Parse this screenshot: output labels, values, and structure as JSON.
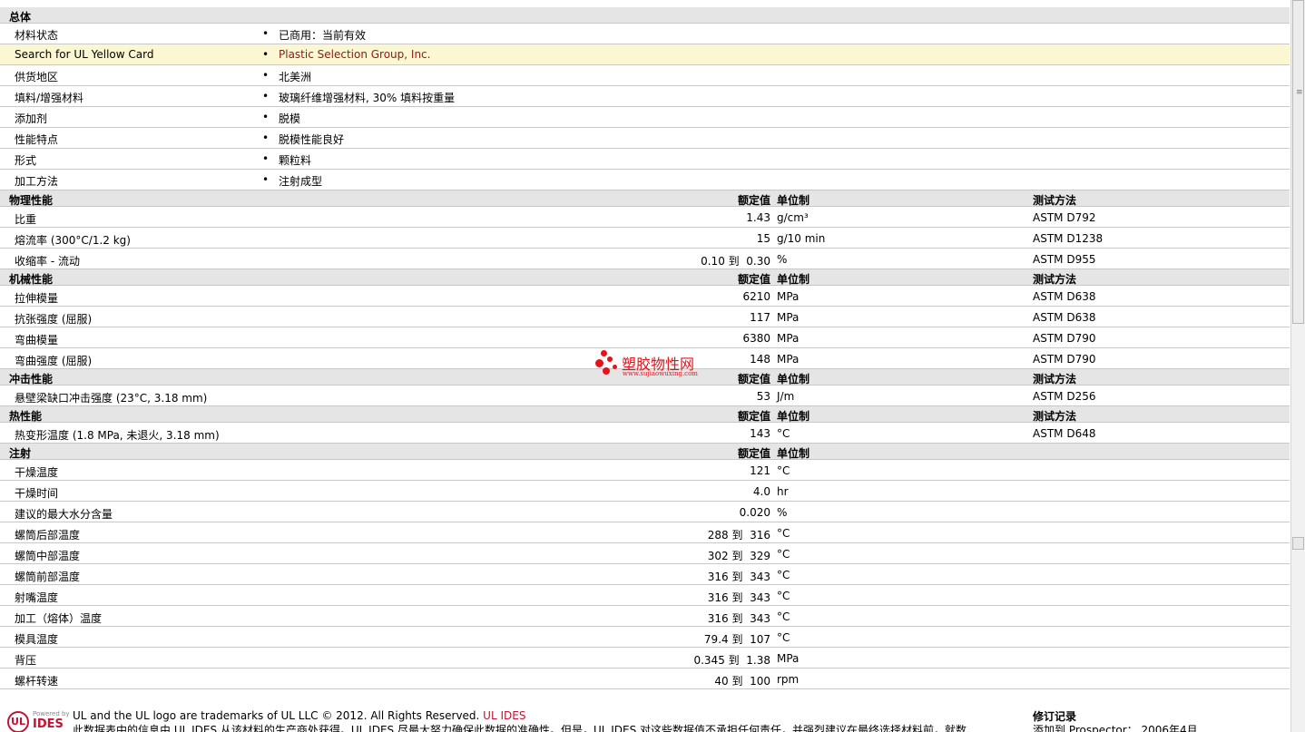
{
  "general": {
    "title": "总体",
    "rows": [
      {
        "label": "材料状态",
        "value": "已商用：当前有效",
        "highlight": false
      },
      {
        "label": "Search for UL Yellow Card",
        "value": "Plastic Selection Group, Inc.",
        "highlight": true
      },
      {
        "label": "供货地区",
        "value": "北美洲",
        "highlight": false
      },
      {
        "label": "填料/增强材料",
        "value": "玻璃纤维增强材料, 30% 填料按重量",
        "highlight": false
      },
      {
        "label": "添加剂",
        "value": "脱模",
        "highlight": false
      },
      {
        "label": "性能特点",
        "value": "脱模性能良好",
        "highlight": false
      },
      {
        "label": "形式",
        "value": "颗粒料",
        "highlight": false
      },
      {
        "label": "加工方法",
        "value": "注射成型",
        "highlight": false
      }
    ]
  },
  "columns": {
    "nominal": "额定值",
    "unit": "单位制",
    "method": "测试方法"
  },
  "sections": [
    {
      "title": "物理性能",
      "show_method": true,
      "rows": [
        {
          "label": "比重",
          "value": "1.43",
          "unit": "g/cm³",
          "method": "ASTM D792"
        },
        {
          "label": "熔流率  (300°C/1.2 kg)",
          "value": "15",
          "unit": "g/10 min",
          "method": "ASTM D1238"
        },
        {
          "label": "收缩率  - 流动",
          "value": "0.10 到  0.30",
          "unit": "%",
          "method": "ASTM D955"
        }
      ]
    },
    {
      "title": "机械性能",
      "show_method": true,
      "rows": [
        {
          "label": "拉伸模量",
          "value": "6210",
          "unit": "MPa",
          "method": "ASTM D638"
        },
        {
          "label": "抗张强度  (屈服)",
          "value": "117",
          "unit": "MPa",
          "method": "ASTM D638"
        },
        {
          "label": "弯曲模量",
          "value": "6380",
          "unit": "MPa",
          "method": "ASTM D790"
        },
        {
          "label": "弯曲强度  (屈服)",
          "value": "148",
          "unit": "MPa",
          "method": "ASTM D790"
        }
      ]
    },
    {
      "title": "冲击性能",
      "show_method": true,
      "rows": [
        {
          "label": "悬壁梁缺口冲击强度  (23°C, 3.18 mm)",
          "value": "53",
          "unit": "J/m",
          "method": "ASTM D256"
        }
      ]
    },
    {
      "title": "热性能",
      "show_method": true,
      "rows": [
        {
          "label": "热变形温度  (1.8 MPa, 未退火, 3.18 mm)",
          "value": "143",
          "unit": "°C",
          "method": "ASTM D648"
        }
      ]
    },
    {
      "title": "注射",
      "show_method": false,
      "rows": [
        {
          "label": "干燥温度",
          "value": "121",
          "unit": "°C",
          "method": ""
        },
        {
          "label": "干燥时间",
          "value": "4.0",
          "unit": "hr",
          "method": ""
        },
        {
          "label": "建议的最大水分含量",
          "value": "0.020",
          "unit": "%",
          "method": ""
        },
        {
          "label": "螺筒后部温度",
          "value": "288 到  316",
          "unit": "°C",
          "method": ""
        },
        {
          "label": "螺筒中部温度",
          "value": "302 到  329",
          "unit": "°C",
          "method": ""
        },
        {
          "label": "螺筒前部温度",
          "value": "316 到  343",
          "unit": "°C",
          "method": ""
        },
        {
          "label": "射嘴温度",
          "value": "316 到  343",
          "unit": "°C",
          "method": ""
        },
        {
          "label": "加工（熔体）温度",
          "value": "316 到  343",
          "unit": "°C",
          "method": ""
        },
        {
          "label": "模具温度",
          "value": "79.4 到  107",
          "unit": "°C",
          "method": ""
        },
        {
          "label": "背压",
          "value": "0.345 到  1.38",
          "unit": "MPa",
          "method": ""
        },
        {
          "label": "螺杆转速",
          "value": "40 到  100",
          "unit": "rpm",
          "method": ""
        }
      ]
    }
  ],
  "watermark": {
    "text": "塑胶物性网",
    "sub": "www.sujiaowuxing.com"
  },
  "footer": {
    "logo_text": "UL",
    "powered": "Powered by",
    "ides": "IDES",
    "line1": "UL and the UL logo are trademarks of UL LLC © 2012. All Rights Reserved. ",
    "line1_link": "UL IDES",
    "line2": "此数据表中的信息由  UL IDES 从该材料的生产商处获得。UL IDES 尽最大努力确保此数据的准确性。但是，UL IDES 对这些数据值不承担任何责任，并强烈建议在最终选择材料前，就数",
    "revision_title": "修订记录",
    "revision_text": "添加到  Prospector：   2006年4月"
  },
  "colors": {
    "accent": "#c41230",
    "highlight_row": "#fbf7d2",
    "header_row": "#e5e5e5",
    "watermark": "#e3121b"
  }
}
